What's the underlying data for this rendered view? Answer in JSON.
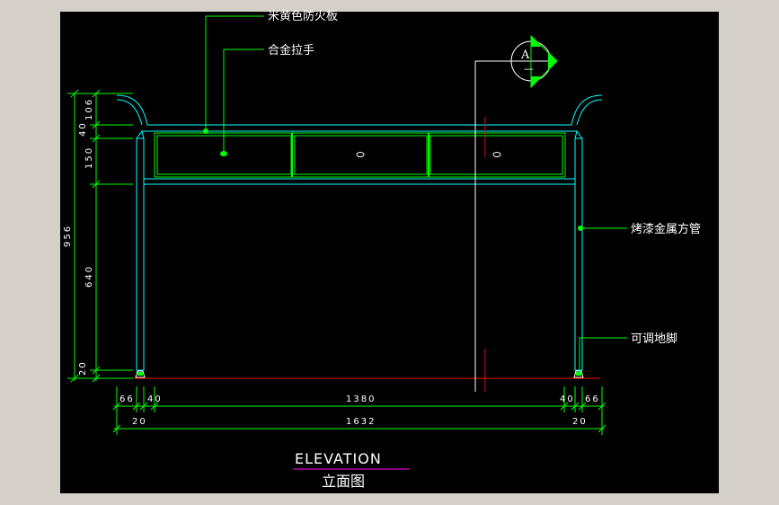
{
  "colors": {
    "frame": "#d4d0c8",
    "background": "#000000",
    "outline": "#00ffff",
    "drawer": "#00ff00",
    "dimension": "#00ff00",
    "leader": "#ffffff",
    "floor": "#ff0000",
    "underline": "#ff00ff"
  },
  "labels": {
    "panel": "米黄色防火板",
    "handle": "合金拉手",
    "tube": "烤漆金属方管",
    "foot": "可调地脚"
  },
  "section_mark": {
    "letter": "A",
    "sheet": "—"
  },
  "dims": {
    "left": {
      "d106": "106",
      "d40": "40",
      "d150": "150",
      "d956": "956",
      "d640": "640",
      "d20": "20"
    },
    "bottom": {
      "d66a": "66",
      "d40a": "40",
      "d1380": "1380",
      "d40b": "40",
      "d66b": "66",
      "d20a": "20",
      "d1632": "1632",
      "d20b": "20"
    }
  },
  "title": {
    "en": "ELEVATION",
    "zh": "立面图"
  }
}
